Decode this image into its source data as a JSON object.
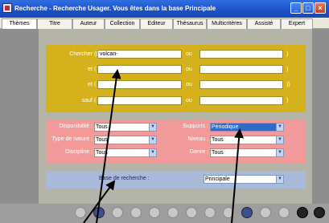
{
  "window": {
    "title": "Recherche - Recherche Usager.  Vous êtes dans la base Principale",
    "controls": {
      "minimize": "_",
      "maximize": "□",
      "close": "×"
    }
  },
  "tabs": [
    {
      "label": "Thèmes",
      "active": true
    },
    {
      "label": "Titre"
    },
    {
      "label": "Auteur"
    },
    {
      "label": "Collection"
    },
    {
      "label": "Editeur"
    },
    {
      "label": "Thésaurus"
    },
    {
      "label": "Multicritères"
    },
    {
      "label": "Assisté"
    },
    {
      "label": "Expert"
    }
  ],
  "search": {
    "rows": [
      {
        "label": "Chercher",
        "open": "((",
        "value": "volcan-",
        "ou": "ou",
        "close": ")"
      },
      {
        "label": "et",
        "open": "(",
        "value": "",
        "ou": "ou",
        "close": ")"
      },
      {
        "label": "et",
        "open": "(",
        "value": "",
        "ou": "ou",
        "close": "))"
      },
      {
        "label": "sauf",
        "open": "(",
        "value": "",
        "ou": "ou",
        "close": ")"
      }
    ]
  },
  "filters": {
    "disponibilite": {
      "label": "Disponibilité :",
      "value": "Tous"
    },
    "type_nature": {
      "label": "Type de nature :",
      "value": "Tous"
    },
    "discipline": {
      "label": "Discipline :",
      "value": "Tous"
    },
    "supports": {
      "label": "Supports :",
      "value": "Périodique"
    },
    "niveau": {
      "label": "Niveau :",
      "value": "Tous"
    },
    "genre": {
      "label": "Genre :",
      "value": "Tous"
    }
  },
  "base": {
    "label": "Base de recherche :",
    "value": "Principale"
  },
  "toolbar_icons": [
    "round-button-icon",
    "eye-icon",
    "tools-icon",
    "round-button-icon",
    "clear-icon",
    "round-button-icon",
    "round-button-icon",
    "grid-icon",
    "round-button-icon",
    "globe-icon",
    "round-button-icon",
    "round-button-icon",
    "close-icon",
    "help-icon"
  ],
  "colors": {
    "titlebar": "#1c50c8",
    "search_panel": "#d5b21c",
    "filter_panel": "#f29a9a",
    "base_panel": "#a9b9da",
    "selected_option": "#316ac5"
  }
}
